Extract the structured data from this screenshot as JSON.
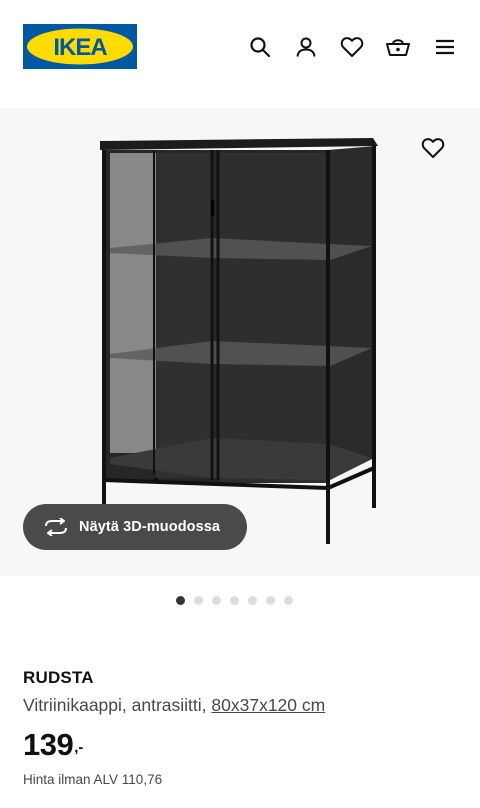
{
  "header": {
    "logo_text": "IKEA",
    "brand_colors": {
      "blue": "#0058a3",
      "yellow": "#ffdb00"
    },
    "icons": [
      "search-icon",
      "user-icon",
      "heart-icon",
      "basket-icon",
      "menu-icon"
    ]
  },
  "gallery": {
    "favorite_icon": "heart-icon",
    "view_3d_label": "Näytä 3D-muodossa",
    "view_3d_icon": "rotate-icon",
    "image_count": 7,
    "active_index": 0
  },
  "product": {
    "name": "RUDSTA",
    "description": "Vitriinikaappi, antrasiitti,",
    "size": "80x37x120 cm",
    "price_integer": "139",
    "price_suffix": ",-",
    "price_ex_vat": "Hinta ilman ALV 110,76"
  }
}
